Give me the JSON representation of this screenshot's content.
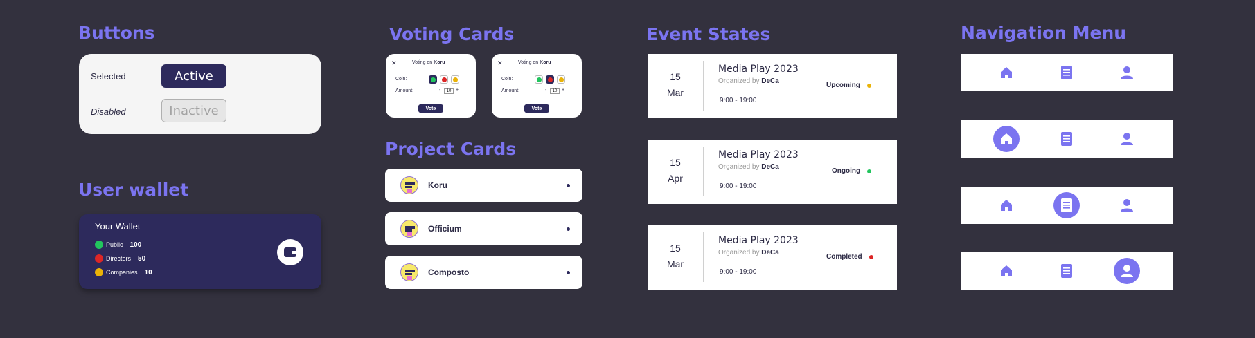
{
  "sections": {
    "buttons": "Buttons",
    "user_wallet": "User wallet",
    "voting_cards": "Voting Cards",
    "project_cards": "Project Cards",
    "event_states": "Event States",
    "navigation_menu": "Navigation Menu"
  },
  "buttons": {
    "selected_label": "Selected",
    "active_label": "Active",
    "disabled_label": "Disabled",
    "inactive_label": "Inactive"
  },
  "wallet": {
    "title": "Your Wallet",
    "rows": [
      {
        "label": "Public",
        "value": "100",
        "color": "#22c55e"
      },
      {
        "label": "Directors",
        "value": "50",
        "color": "#dc2626"
      },
      {
        "label": "Companies",
        "value": "10",
        "color": "#eab308"
      }
    ],
    "icon": "wallet-icon"
  },
  "voting": {
    "cards": [
      {
        "prefix": "Voting on",
        "project": "Koru",
        "coin_label": "Coin:",
        "amount_label": "Amount:",
        "amount": "10",
        "minus": "-",
        "plus": "+",
        "vote_label": "Vote",
        "close": "✕",
        "selected_coin": 0
      },
      {
        "prefix": "Voting on",
        "project": "Koru",
        "coin_label": "Coin:",
        "amount_label": "Amount:",
        "amount": "10",
        "minus": "-",
        "plus": "+",
        "vote_label": "Vote",
        "close": "✕",
        "selected_coin": 1
      }
    ],
    "coin_colors": [
      "#22c55e",
      "#dc2626",
      "#eab308"
    ]
  },
  "projects": [
    {
      "name": "Koru"
    },
    {
      "name": "Officium"
    },
    {
      "name": "Composto"
    }
  ],
  "events": [
    {
      "day": "15",
      "month": "Mar",
      "title": "Media Play 2023",
      "org_prefix": "Organized by",
      "org": "DeCa",
      "time": "9:00 - 19:00",
      "status": "Upcoming",
      "status_color": "#eab308"
    },
    {
      "day": "15",
      "month": "Apr",
      "title": "Media Play 2023",
      "org_prefix": "Organized by",
      "org": "DeCa",
      "time": "9:00 - 19:00",
      "status": "Ongoing",
      "status_color": "#22c55e"
    },
    {
      "day": "15",
      "month": "Mar",
      "title": "Media Play 2023",
      "org_prefix": "Organized by",
      "org": "DeCa",
      "time": "9:00 - 19:00",
      "status": "Completed",
      "status_color": "#dc2626"
    }
  ],
  "navigation": {
    "icons": [
      "home-icon",
      "document-icon",
      "user-icon"
    ],
    "active_states": [
      "none",
      "home",
      "document",
      "user"
    ]
  },
  "colors": {
    "background": "#33313e",
    "accent": "#7b74f0",
    "navy": "#2d2a5c"
  }
}
